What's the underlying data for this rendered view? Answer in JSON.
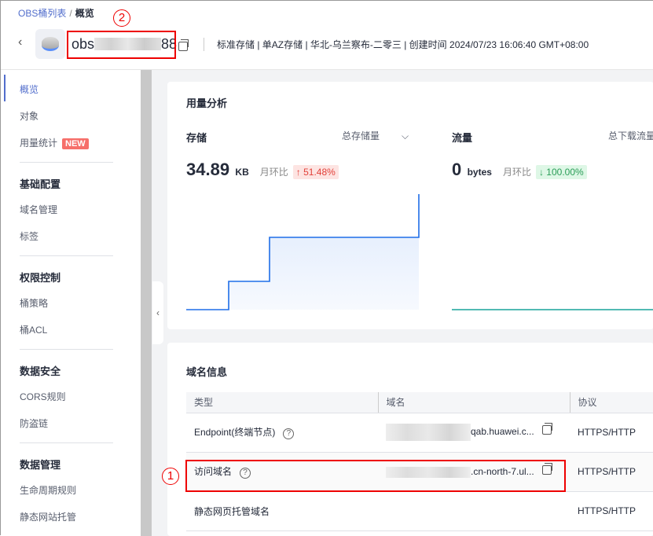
{
  "breadcrumb": {
    "parent": "OBS桶列表",
    "separator": "/",
    "current": "概览"
  },
  "bucket": {
    "name_prefix": "obs",
    "name_suffix": "88",
    "meta": "标准存储 | 单AZ存储 | 华北-乌兰察布-二零三 | 创建时间  2024/07/23 16:06:40 GMT+08:00"
  },
  "sidebar": {
    "items": [
      {
        "label": "概览"
      },
      {
        "label": "对象"
      },
      {
        "label": "用量统计",
        "badge": "NEW"
      }
    ],
    "groups": [
      {
        "title": "基础配置",
        "items": [
          "域名管理",
          "标签"
        ]
      },
      {
        "title": "权限控制",
        "items": [
          "桶策略",
          "桶ACL"
        ]
      },
      {
        "title": "数据安全",
        "items": [
          "CORS规则",
          "防盗链"
        ]
      },
      {
        "title": "数据管理",
        "items": [
          "生命周期规则",
          "静态网站托管"
        ]
      }
    ]
  },
  "usage": {
    "title": "用量分析",
    "storage": {
      "title": "存储",
      "selector": "总存储量",
      "value": "34.89",
      "unit": "KB",
      "mom_label": "月环比",
      "mom": "↑ 51.48%"
    },
    "traffic": {
      "title": "流量",
      "selector": "总下载流量",
      "value": "0",
      "unit": "bytes",
      "mom_label": "月环比",
      "mom": "↓ 100.00%"
    }
  },
  "domain": {
    "title": "域名信息",
    "headers": [
      "类型",
      "域名",
      "协议"
    ],
    "rows": [
      {
        "type": "Endpoint(终端节点)",
        "domain": "qab.huawei.c...",
        "protocol": "HTTPS/HTTP"
      },
      {
        "type": "访问域名",
        "domain": ".cn-north-7.ul...",
        "protocol": "HTTPS/HTTP"
      },
      {
        "type": "静态网页托管域名",
        "domain": "",
        "protocol": "HTTPS/HTTP"
      }
    ]
  },
  "annotations": {
    "one": "1",
    "two": "2"
  },
  "colors": {
    "accent": "#526ecc",
    "storage_line": "#1f6ee8",
    "traffic_line": "#19a39a"
  }
}
